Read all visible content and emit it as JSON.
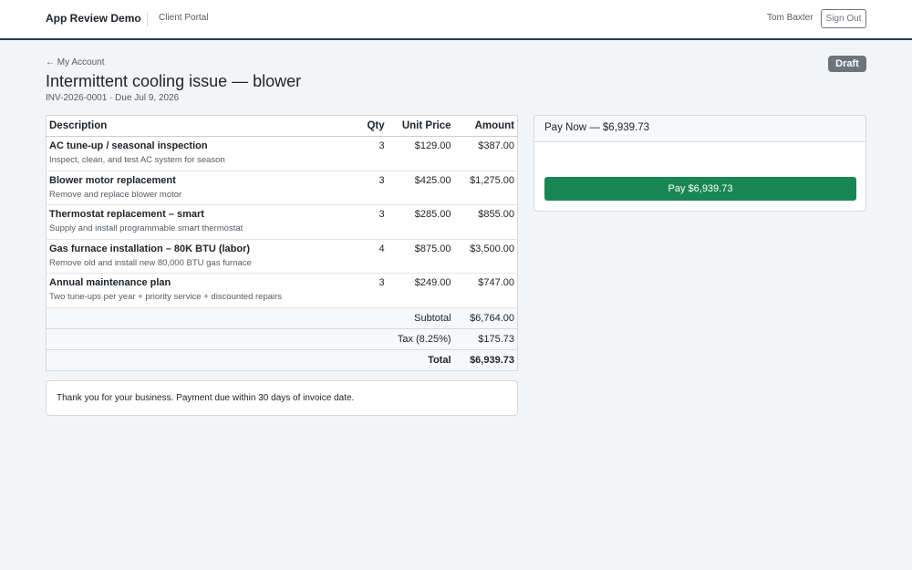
{
  "nav": {
    "brand": "App Review Demo",
    "portal": "Client Portal",
    "user": "Tom Baxter",
    "sign_out": "Sign Out"
  },
  "header": {
    "back_link": "← My Account",
    "status_badge": "Draft",
    "title": "Intermittent cooling issue — blower",
    "subtitle": "INV-2026-0001 · Due Jul 9, 2026"
  },
  "table": {
    "columns": {
      "description": "Description",
      "qty": "Qty",
      "unit_price": "Unit Price",
      "amount": "Amount"
    },
    "items": [
      {
        "name": "AC tune-up / seasonal inspection",
        "desc": "Inspect, clean, and test AC system for season",
        "qty": "3",
        "unit_price": "$129.00",
        "amount": "$387.00"
      },
      {
        "name": "Blower motor replacement",
        "desc": "Remove and replace blower motor",
        "qty": "3",
        "unit_price": "$425.00",
        "amount": "$1,275.00"
      },
      {
        "name": "Thermostat replacement – smart",
        "desc": "Supply and install programmable smart thermostat",
        "qty": "3",
        "unit_price": "$285.00",
        "amount": "$855.00"
      },
      {
        "name": "Gas furnace installation – 80K BTU (labor)",
        "desc": "Remove old and install new 80,000 BTU gas furnace",
        "qty": "4",
        "unit_price": "$875.00",
        "amount": "$3,500.00"
      },
      {
        "name": "Annual maintenance plan",
        "desc": "Two tune-ups per year + priority service + discounted repairs",
        "qty": "3",
        "unit_price": "$249.00",
        "amount": "$747.00"
      }
    ],
    "summary": {
      "subtotal_label": "Subtotal",
      "subtotal": "$6,764.00",
      "tax_label": "Tax (8.25%)",
      "tax": "$175.73",
      "total_label": "Total",
      "total": "$6,939.73"
    }
  },
  "note": "Thank you for your business. Payment due within 30 days of invoice date.",
  "pay": {
    "header": "Pay Now — $6,939.73",
    "button": "Pay $6,939.73"
  },
  "colors": {
    "accent_green": "#198754",
    "badge_gray": "#6c757d",
    "nav_border": "#1f3a4d"
  }
}
